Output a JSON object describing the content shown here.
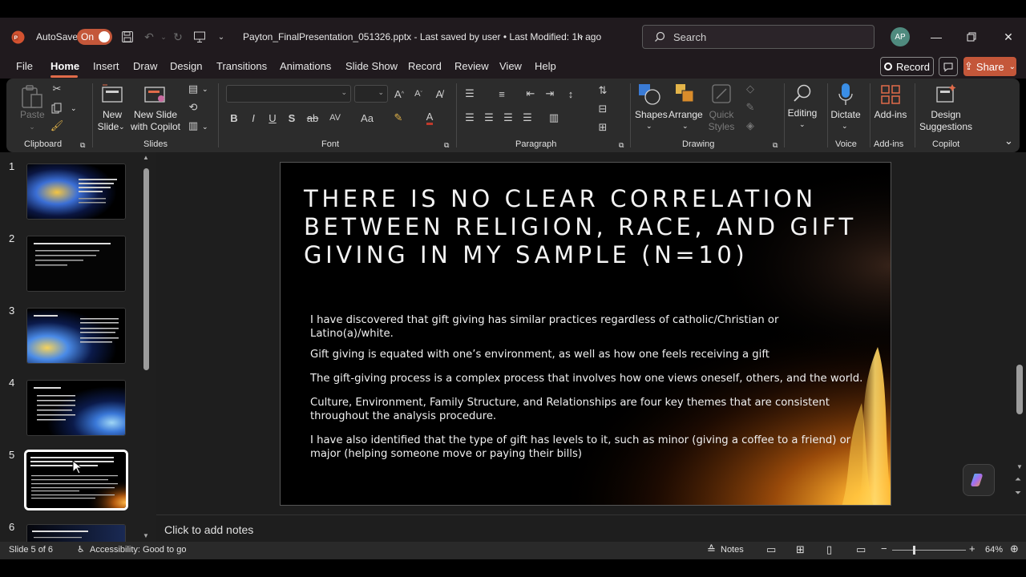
{
  "titlebar": {
    "autosave_label": "AutoSave",
    "autosave_state": "On",
    "file_title": "Payton_FinalPresentation_051326.pptx  -  Last saved by user  •  Last Modified: 1h ago",
    "search_placeholder": "Search",
    "avatar_initials": "AP"
  },
  "menu": {
    "tabs": [
      "File",
      "Home",
      "Insert",
      "Draw",
      "Design",
      "Transitions",
      "Animations",
      "Slide Show",
      "Record",
      "Review",
      "View",
      "Help"
    ],
    "active_tab": "Home",
    "record_label": "Record",
    "share_label": "Share"
  },
  "ribbon": {
    "clipboard": {
      "paste": "Paste",
      "label": "Clipboard"
    },
    "slides": {
      "new_slide": "New",
      "new_slide2": "Slide",
      "new_copilot": "New Slide",
      "new_copilot2": "with Copilot",
      "label": "Slides"
    },
    "font": {
      "label": "Font"
    },
    "paragraph": {
      "label": "Paragraph"
    },
    "drawing": {
      "shapes": "Shapes",
      "arrange": "Arrange",
      "quick_styles": "Quick",
      "quick_styles2": "Styles",
      "label": "Drawing"
    },
    "editing": {
      "label": "Editing"
    },
    "voice": {
      "dictate": "Dictate",
      "label": "Voice"
    },
    "addins": {
      "btn": "Add-ins",
      "label": "Add-ins"
    },
    "copilot": {
      "design": "Design",
      "design2": "Suggestions",
      "label": "Copilot"
    }
  },
  "thumbnails": [
    {
      "num": "1",
      "title": "Ethnographic Methods Class Final Presentation by Andrew Payton"
    },
    {
      "num": "2",
      "title": "Sample Size Used for Final Analysis"
    },
    {
      "num": "3",
      "title": "Themes Identified"
    },
    {
      "num": "4",
      "title": "Themes Continued"
    },
    {
      "num": "5",
      "title": "There is no clear correlation between religion, race, and gift giving in my sample (n=10)"
    },
    {
      "num": "6",
      "title": "Gift giving and Mystical Awareness"
    }
  ],
  "slide": {
    "title": "There is no clear correlation between religion, race, and gift giving in my sample (n=10)",
    "bullets": [
      "I have discovered that gift giving has similar practices regardless of catholic/Christian or Latino(a)/white.",
      "Gift giving is equated with one’s environment, as well as how one feels receiving a gift",
      "The gift-giving process is a complex process that involves how one views oneself, others, and the world.",
      "Culture, Environment, Family Structure, and Relationships are four key themes that are consistent throughout the analysis procedure.",
      "I have also identified that the type of gift has levels to it, such as minor (giving a coffee to a friend) or major (helping someone move or paying their bills)"
    ]
  },
  "notes": {
    "placeholder": "Click to add notes"
  },
  "status": {
    "slide_counter": "Slide 5 of 6",
    "accessibility": "Accessibility: Good to go",
    "notes_label": "Notes",
    "zoom": "64%"
  },
  "colors": {
    "accent": "#c4573a",
    "tab_underline": "#e06b4a"
  }
}
